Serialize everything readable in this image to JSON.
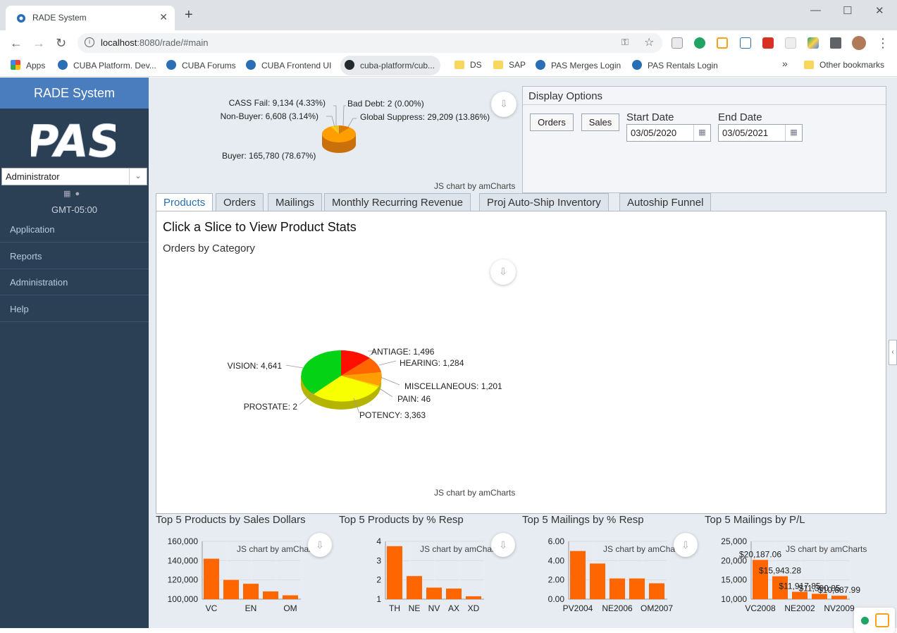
{
  "browser": {
    "tab_title": "RADE System",
    "url_host": "localhost",
    "url_rest": ":8080/rade/#main",
    "bookmarks": [
      "Apps",
      "CUBA Platform. Dev...",
      "CUBA Forums",
      "CUBA Frontend UI",
      "cuba-platform/cub...",
      "DS",
      "SAP",
      "PAS Merges Login",
      "PAS Rentals Login",
      "Other bookmarks"
    ]
  },
  "sidebar": {
    "title": "RADE System",
    "logo_text": "PAS",
    "user": "Administrator",
    "timezone": "GMT-05:00",
    "menu": [
      "Application",
      "Reports",
      "Administration",
      "Help"
    ]
  },
  "top_pie": {
    "labels": [
      "CASS Fail: 9,134 (4.33%)",
      "Bad Debt: 2 (0.00%)",
      "Non-Buyer: 6,608 (3.14%)",
      "Global Suppress: 29,209 (13.86%)",
      "Buyer: 165,780 (78.67%)"
    ],
    "credit": "JS chart by amCharts"
  },
  "display_options": {
    "title": "Display Options",
    "orders_label": "Orders",
    "sales_label": "Sales",
    "start_label": "Start Date",
    "end_label": "End Date",
    "start_value": "03/05/2020",
    "end_value": "03/05/2021"
  },
  "tabs": [
    "Products",
    "Orders",
    "Mailings",
    "Monthly Recurring Revenue",
    "Proj Auto-Ship Inventory",
    "Autoship Funnel"
  ],
  "panel": {
    "heading": "Click a Slice to View Product Stats",
    "subheading": "Orders by Category",
    "credit": "JS chart by amCharts"
  },
  "mini_titles": [
    "Top 5 Products by Sales Dollars",
    "Top 5 Products by % Resp",
    "Top 5 Mailings by % Resp",
    "Top 5 Mailings by P/L"
  ],
  "chart_data": [
    {
      "type": "pie",
      "categories": [
        "Buyer",
        "Global Suppress",
        "CASS Fail",
        "Non-Buyer",
        "Bad Debt"
      ],
      "values": [
        165780,
        29209,
        9134,
        6608,
        2
      ],
      "colors": [
        "#ff9e01",
        "#d97b04",
        "#fcd202",
        "#e8c23b",
        "#b0de09"
      ]
    },
    {
      "type": "pie",
      "title": "Orders by Category",
      "categories": [
        "ANTIAGE",
        "HEARING",
        "MISCELLANEOUS",
        "PAIN",
        "POTENCY",
        "PROSTATE",
        "VISION"
      ],
      "values": [
        1496,
        1284,
        1201,
        46,
        3363,
        2,
        4641
      ],
      "colors": [
        "#ff0f00",
        "#ff6600",
        "#ff9e01",
        "#fcd202",
        "#f8ff01",
        "#b0de09",
        "#04d215"
      ]
    },
    {
      "type": "bar",
      "title": "Top 5 Products by Sales Dollars",
      "categories": [
        "VC",
        "",
        "EN",
        "",
        "OM"
      ],
      "values": [
        142000,
        120000,
        116000,
        108000,
        104000
      ],
      "ylim": [
        100000,
        160000
      ],
      "yticks": [
        "160,000",
        "140,000",
        "120,000",
        "100,000"
      ]
    },
    {
      "type": "bar",
      "title": "Top 5 Products by % Resp",
      "categories": [
        "TH",
        "NE",
        "NV",
        "AX",
        "XD"
      ],
      "values": [
        3.75,
        2.2,
        1.6,
        1.55,
        1.15
      ],
      "ylim": [
        1,
        4
      ],
      "yticks": [
        "4",
        "3",
        "2",
        "1"
      ]
    },
    {
      "type": "bar",
      "title": "Top 5 Mailings by % Resp",
      "categories": [
        "PV2004",
        "",
        "NE2006",
        "",
        "OM2007"
      ],
      "values": [
        5.0,
        3.7,
        2.15,
        2.15,
        1.65
      ],
      "ylim": [
        0,
        6
      ],
      "yticks": [
        "6.00",
        "4.00",
        "2.00",
        "0.00"
      ]
    },
    {
      "type": "bar",
      "title": "Top 5 Mailings by P/L",
      "categories": [
        "VC2008",
        "",
        "NE2002",
        "",
        "NV2009"
      ],
      "values": [
        20187.06,
        15943.28,
        11917.85,
        11390.85,
        10887.99
      ],
      "data_labels": [
        "$20,187.06",
        "$15,943.28",
        "$11,917.85",
        "$11,390.85",
        "$10,887.99"
      ],
      "ylim": [
        10000,
        25000
      ],
      "yticks": [
        "25,000",
        "20,000",
        "15,000",
        "10,000"
      ]
    }
  ]
}
